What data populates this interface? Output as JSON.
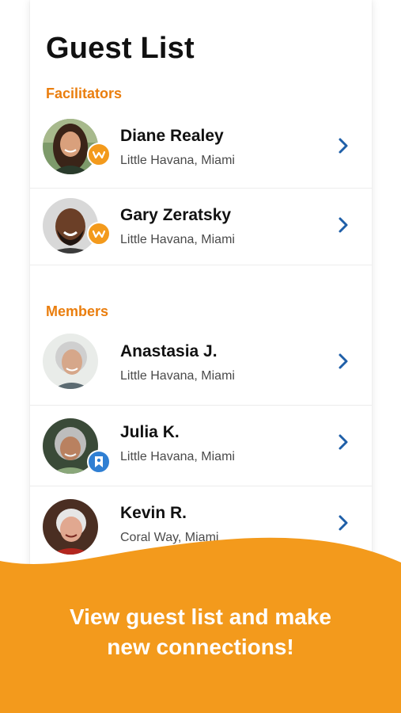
{
  "title": "Guest List",
  "sections": [
    {
      "label": "Facilitators",
      "guests": [
        {
          "name": "Diane Realey",
          "location": "Little Havana, Miami",
          "badge": "facilitator-badge-icon"
        },
        {
          "name": "Gary Zeratsky",
          "location": "Little Havana, Miami",
          "badge": "facilitator-badge-icon"
        }
      ]
    },
    {
      "label": "Members",
      "guests": [
        {
          "name": "Anastasia J.",
          "location": "Little Havana, Miami",
          "badge": ""
        },
        {
          "name": "Julia K.",
          "location": "Little Havana, Miami",
          "badge": "ribbon-badge-icon"
        },
        {
          "name": "Kevin R.",
          "location": "Coral Way, Miami",
          "badge": ""
        }
      ]
    }
  ],
  "footer": {
    "line1": "View guest list and make",
    "line2": "new connections!"
  },
  "colors": {
    "accent_orange": "#f39a1c",
    "section_label": "#ea7e0e",
    "chevron_blue": "#1f5fa8",
    "badge_blue": "#2f7fd3"
  }
}
